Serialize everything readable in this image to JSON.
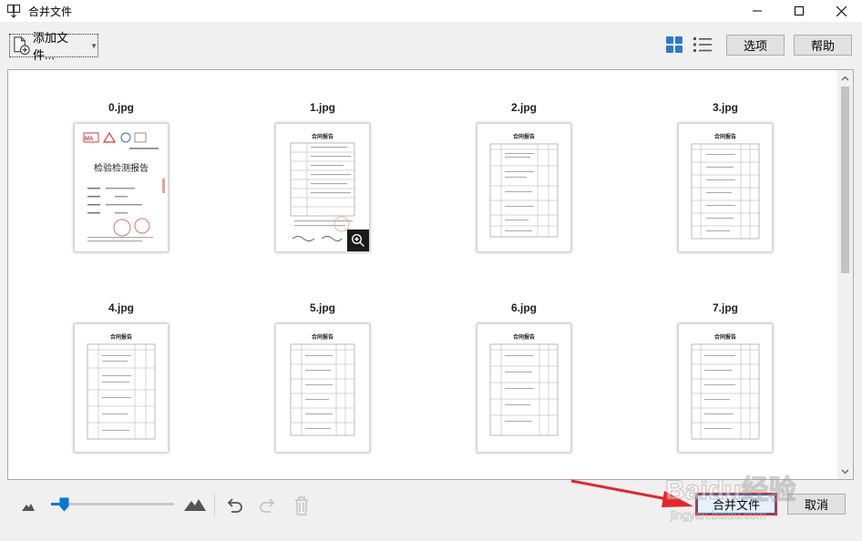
{
  "window": {
    "title": "合并文件"
  },
  "toolbar": {
    "add_files_label": "添加文件...",
    "options_label": "选项",
    "help_label": "帮助"
  },
  "thumbnails": [
    {
      "name": "0.jpg",
      "kind": "cover",
      "cover_title": "检验检测报告"
    },
    {
      "name": "1.jpg",
      "kind": "contract",
      "heading": "合同报告"
    },
    {
      "name": "2.jpg",
      "kind": "table",
      "heading": "合同报告"
    },
    {
      "name": "3.jpg",
      "kind": "table",
      "heading": "合同报告"
    },
    {
      "name": "4.jpg",
      "kind": "table",
      "heading": "合同报告"
    },
    {
      "name": "5.jpg",
      "kind": "table",
      "heading": "合同报告"
    },
    {
      "name": "6.jpg",
      "kind": "table",
      "heading": "合同报告"
    },
    {
      "name": "7.jpg",
      "kind": "table",
      "heading": "合同报告"
    }
  ],
  "footer": {
    "merge_label": "合并文件",
    "cancel_label": "取消",
    "zoom_level": 0.1
  },
  "watermark": {
    "brand": "Baidu经验",
    "url": "jingyan.baidu.com"
  },
  "colors": {
    "accent": "#0078d7",
    "highlight_border": "#e5252a",
    "annotation_arrow": "#e5252a"
  },
  "icons": {
    "app": "merge-files-icon",
    "grid_view": "grid-view-icon",
    "list_view": "list-view-icon",
    "undo": "undo-icon",
    "redo": "redo-icon",
    "delete": "trash-icon",
    "zoom": "zoom-in-icon"
  }
}
